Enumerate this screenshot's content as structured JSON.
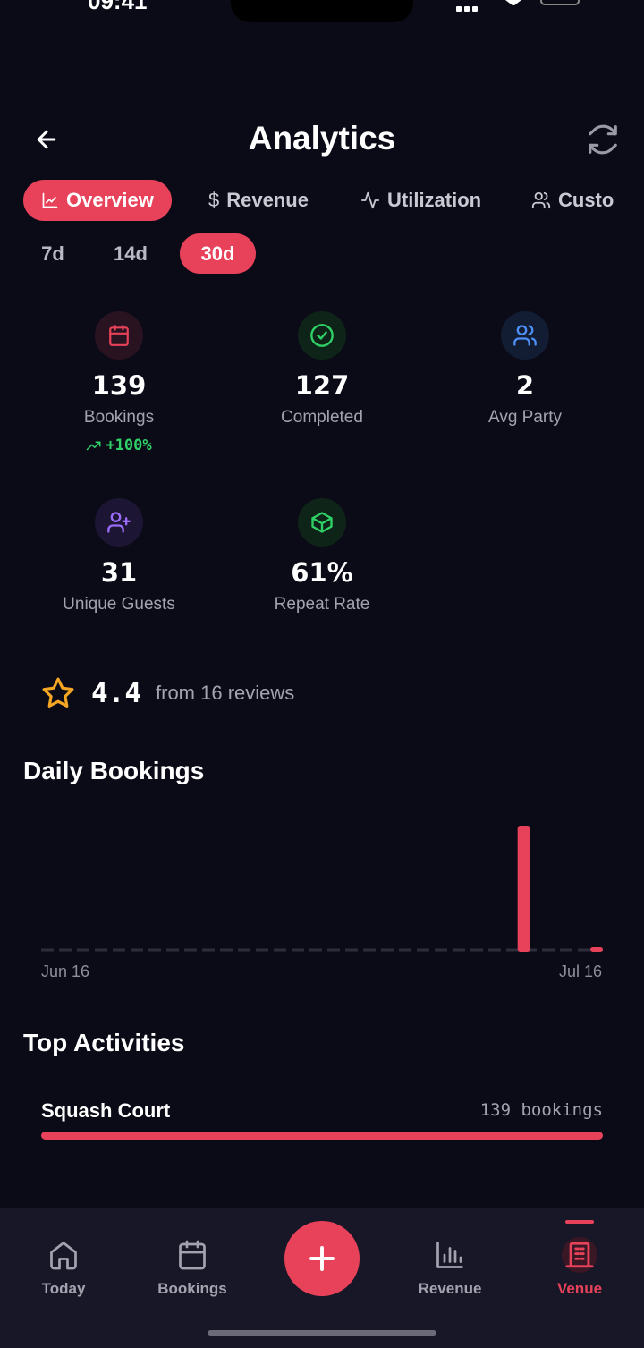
{
  "statusbar": {
    "time": "09:41"
  },
  "header": {
    "title": "Analytics"
  },
  "tabs": [
    {
      "label": "Overview",
      "icon": "line-chart-icon",
      "active": true
    },
    {
      "label": "Revenue",
      "icon": "dollar-icon",
      "active": false
    },
    {
      "label": "Utilization",
      "icon": "activity-icon",
      "active": false
    },
    {
      "label": "Custo",
      "icon": "users-icon",
      "active": false
    }
  ],
  "ranges": [
    {
      "label": "7d",
      "active": false
    },
    {
      "label": "14d",
      "active": false
    },
    {
      "label": "30d",
      "active": true
    }
  ],
  "stats": [
    {
      "value": "139",
      "label": "Bookings",
      "trend": "+100%",
      "icon": "calendar-icon",
      "color": "#e8425a"
    },
    {
      "value": "127",
      "label": "Completed",
      "icon": "check-circle-icon",
      "color": "#2fd167"
    },
    {
      "value": "2",
      "label": "Avg Party",
      "icon": "users-icon",
      "color": "#4d8ff5"
    },
    {
      "value": "31",
      "label": "Unique Guests",
      "icon": "user-plus-icon",
      "color": "#9b6cf6"
    },
    {
      "value": "61%",
      "label": "Repeat Rate",
      "icon": "box-icon",
      "color": "#2fd167"
    }
  ],
  "rating": {
    "score": "4.4",
    "text": "from 16 reviews",
    "icon": "star-icon",
    "color": "#f5a623"
  },
  "daily_bookings": {
    "title": "Daily Bookings",
    "start_label": "Jun 16",
    "end_label": "Jul 16"
  },
  "chart_data": {
    "type": "bar",
    "title": "Daily Bookings",
    "xlabel": "",
    "ylabel": "",
    "x_start": "Jun 16",
    "x_end": "Jul 16",
    "values": [
      0,
      0,
      0,
      0,
      0,
      0,
      0,
      0,
      0,
      0,
      0,
      0,
      0,
      0,
      0,
      0,
      0,
      0,
      0,
      0,
      0,
      0,
      0,
      0,
      0,
      0,
      0,
      138,
      0,
      0,
      0,
      1
    ],
    "ylim": [
      0,
      138
    ],
    "grid": false,
    "color": "#e8425a"
  },
  "top_activities": {
    "title": "Top Activities",
    "items": [
      {
        "name": "Squash Court",
        "count": "139 bookings",
        "share": 1.0
      }
    ]
  },
  "nav": {
    "items": [
      {
        "label": "Today",
        "icon": "home-icon",
        "active": false
      },
      {
        "label": "Bookings",
        "icon": "calendar-icon",
        "active": false
      },
      {
        "label": "Revenue",
        "icon": "bar-chart-icon",
        "active": false
      },
      {
        "label": "Venue",
        "icon": "building-icon",
        "active": true
      }
    ],
    "fab_icon": "plus-icon"
  },
  "colors": {
    "accent": "#e8425a",
    "background": "#0b0b17",
    "success": "#2fd167"
  }
}
